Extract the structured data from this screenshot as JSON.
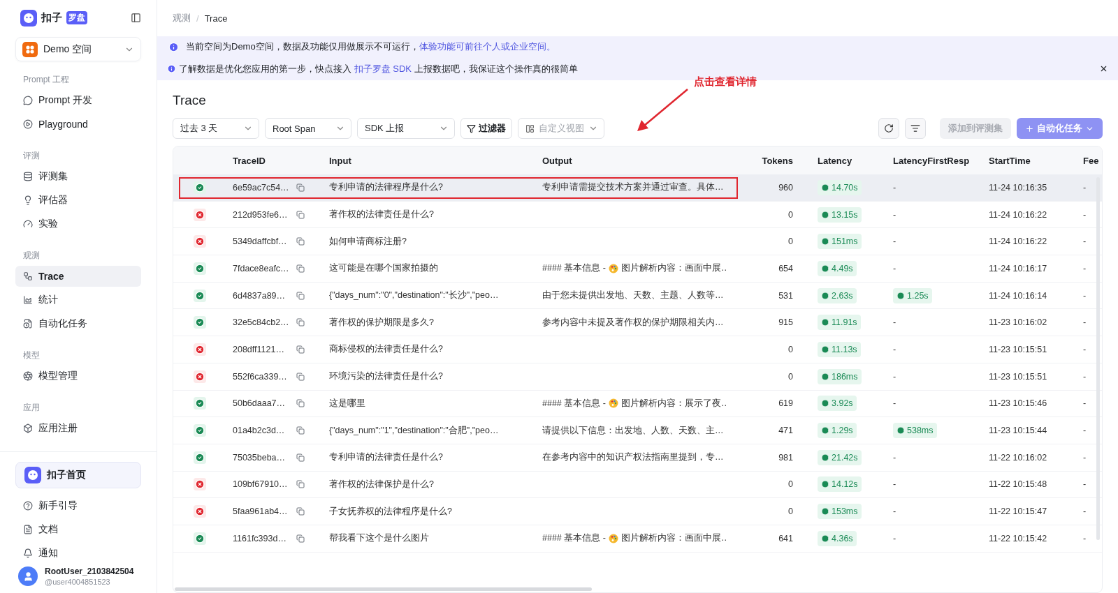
{
  "sidebar": {
    "brand": {
      "name": "扣子",
      "tag": "罗盘"
    },
    "workspace": "Demo 空间",
    "sections": [
      {
        "label": "Prompt 工程",
        "items": [
          {
            "label": "Prompt 开发",
            "selected": false
          },
          {
            "label": "Playground",
            "selected": false
          }
        ]
      },
      {
        "label": "评测",
        "items": [
          {
            "label": "评测集",
            "selected": false
          },
          {
            "label": "评估器",
            "selected": false
          },
          {
            "label": "实验",
            "selected": false
          }
        ]
      },
      {
        "label": "观测",
        "items": [
          {
            "label": "Trace",
            "selected": true
          },
          {
            "label": "统计",
            "selected": false
          },
          {
            "label": "自动化任务",
            "selected": false
          }
        ]
      },
      {
        "label": "模型",
        "items": [
          {
            "label": "模型管理",
            "selected": false
          }
        ]
      },
      {
        "label": "应用",
        "items": [
          {
            "label": "应用注册",
            "selected": false
          }
        ]
      }
    ],
    "home": "扣子首页",
    "footer_items": [
      "新手引导",
      "文档",
      "通知"
    ],
    "user": {
      "name": "RootUser_2103842504",
      "handle": "@user4004851523"
    }
  },
  "breadcrumb": {
    "items": [
      "观测",
      "Trace"
    ],
    "separator": "/"
  },
  "banners": [
    {
      "text": "当前空间为Demo空间，数据及功能仅用做展示不可运行，",
      "link": "体验功能可前往个人或企业空间。",
      "closable": false
    },
    {
      "text": "了解数据是优化您应用的第一步，快点接入 ",
      "link": "扣子罗盘 SDK",
      "after": " 上报数据吧，我保证这个操作真的很简单",
      "closable": true
    }
  ],
  "title": "Trace",
  "filters": [
    {
      "value": "过去 3 天"
    },
    {
      "value": "Root Span"
    },
    {
      "value": "SDK 上报"
    }
  ],
  "filter_button": "过滤器",
  "view_select": {
    "placeholder": "自定义视图"
  },
  "actions": [
    {
      "label": "添加到评测集",
      "disabled": true,
      "primary": false
    },
    {
      "label": "自动化任务",
      "disabled": true,
      "primary": true
    }
  ],
  "annotation": {
    "text": "点击查看详情"
  },
  "table": {
    "columns": [
      "TraceID",
      "Input",
      "Output",
      "Tokens",
      "Latency",
      "LatencyFirstResp",
      "StartTime",
      "Fee"
    ],
    "rows": [
      {
        "kind": "success",
        "selected": true,
        "id": "6e59ac7c54…",
        "input": "专利申请的法律程序是什么?",
        "output": "专利申请需提交技术方案并通过审查。具体…",
        "tokens": "960",
        "latency": "14.70s",
        "first_resp": {
          "kind": "dash",
          "text": "-"
        },
        "start": "11-24 10:16:35",
        "fee": "-"
      },
      {
        "kind": "error",
        "selected": false,
        "id": "212d953fe6…",
        "input": "著作权的法律责任是什么?",
        "tokens": "0",
        "latency": "13.15s",
        "first_resp": {
          "kind": "dash",
          "text": "-"
        },
        "start": "11-24 10:16:22",
        "fee": "-"
      },
      {
        "kind": "error",
        "selected": false,
        "id": "5349daffcbf…",
        "input": "如何申请商标注册?",
        "tokens": "0",
        "latency": "151ms",
        "first_resp": {
          "kind": "dash",
          "text": "-"
        },
        "start": "11-24 10:16:22",
        "fee": "-"
      },
      {
        "kind": "success",
        "selected": false,
        "id": "7fdace8eafc…",
        "input": "这可能是在哪个国家拍摄的",
        "output_prefix": "#### 基本信息 -",
        "output": "图片解析内容：画面中展…",
        "tokens": "654",
        "latency": "4.49s",
        "first_resp": {
          "kind": "dash",
          "text": "-"
        },
        "start": "11-24 10:16:17",
        "fee": "-"
      },
      {
        "kind": "success",
        "selected": false,
        "id": "6d4837a89…",
        "input": "{\"days_num\":\"0\",\"destination\":\"长沙\",\"peo…",
        "output": "由于您未提供出发地、天数、主题、人数等…",
        "tokens": "531",
        "latency": "2.63s",
        "first_resp": {
          "kind": "chip",
          "text": "1.25s"
        },
        "start": "11-24 10:16:14",
        "fee": "-"
      },
      {
        "kind": "success",
        "selected": false,
        "id": "32e5c84cb2…",
        "input": "著作权的保护期限是多久?",
        "output": "参考内容中未提及著作权的保护期限相关内…",
        "tokens": "915",
        "latency": "11.91s",
        "first_resp": {
          "kind": "dash",
          "text": "-"
        },
        "start": "11-23 10:16:02",
        "fee": "-"
      },
      {
        "kind": "error",
        "selected": false,
        "id": "208dff1121…",
        "input": "商标侵权的法律责任是什么?",
        "tokens": "0",
        "latency": "11.13s",
        "first_resp": {
          "kind": "dash",
          "text": "-"
        },
        "start": "11-23 10:15:51",
        "fee": "-"
      },
      {
        "kind": "error",
        "selected": false,
        "id": "552f6ca339…",
        "input": "环境污染的法律责任是什么?",
        "tokens": "0",
        "latency": "186ms",
        "first_resp": {
          "kind": "dash",
          "text": "-"
        },
        "start": "11-23 10:15:51",
        "fee": "-"
      },
      {
        "kind": "success",
        "selected": false,
        "id": "50b6daaa7…",
        "input": "这是哪里",
        "output_prefix": "#### 基本信息 -",
        "output": "图片解析内容：展示了夜…",
        "tokens": "619",
        "latency": "3.92s",
        "first_resp": {
          "kind": "dash",
          "text": "-"
        },
        "start": "11-23 10:15:46",
        "fee": "-"
      },
      {
        "kind": "success",
        "selected": false,
        "id": "01a4b2c3d…",
        "input": "{\"days_num\":\"1\",\"destination\":\"合肥\",\"peo…",
        "output": "请提供以下信息：出发地、人数、天数、主…",
        "tokens": "471",
        "latency": "1.29s",
        "first_resp": {
          "kind": "chip",
          "text": "538ms"
        },
        "start": "11-23 10:15:44",
        "fee": "-"
      },
      {
        "kind": "success",
        "selected": false,
        "id": "75035beba…",
        "input": "专利申请的法律责任是什么?",
        "output": "在参考内容中的知识产权法指南里提到，专…",
        "tokens": "981",
        "latency": "21.42s",
        "first_resp": {
          "kind": "dash",
          "text": "-"
        },
        "start": "11-22 10:16:02",
        "fee": "-"
      },
      {
        "kind": "error",
        "selected": false,
        "id": "109bf67910…",
        "input": "著作权的法律保护是什么?",
        "tokens": "0",
        "latency": "14.12s",
        "first_resp": {
          "kind": "dash",
          "text": "-"
        },
        "start": "11-22 10:15:48",
        "fee": "-"
      },
      {
        "kind": "error",
        "selected": false,
        "id": "5faa961ab4…",
        "input": "子女抚养权的法律程序是什么?",
        "tokens": "0",
        "latency": "153ms",
        "first_resp": {
          "kind": "dash",
          "text": "-"
        },
        "start": "11-22 10:15:47",
        "fee": "-"
      },
      {
        "kind": "success",
        "selected": false,
        "id": "1161fc393d…",
        "input": "帮我看下这个是什么图片",
        "output_prefix": "#### 基本信息 -",
        "output": "图片解析内容：画面中展…",
        "tokens": "641",
        "latency": "4.36s",
        "first_resp": {
          "kind": "dash",
          "text": "-"
        },
        "start": "11-22 10:15:42",
        "fee": "-"
      }
    ]
  }
}
